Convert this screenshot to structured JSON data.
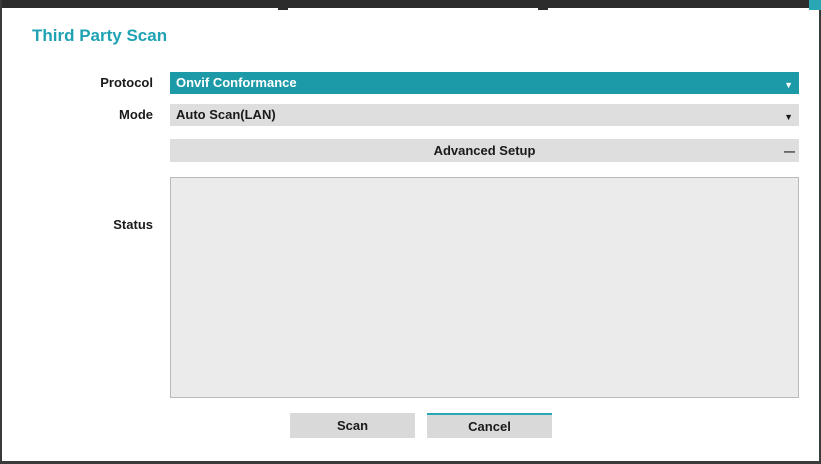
{
  "dialog": {
    "title": "Third Party Scan"
  },
  "form": {
    "protocol_label": "Protocol",
    "protocol_value": "Onvif Conformance",
    "mode_label": "Mode",
    "mode_value": "Auto Scan(LAN)",
    "advanced_label": "Advanced Setup",
    "status_label": "Status"
  },
  "buttons": {
    "scan_label": "Scan",
    "cancel_label": "Cancel"
  },
  "icons": {
    "dropdown": "chevron-down-icon",
    "collapse": "collapse-icon"
  },
  "colors": {
    "accent": "#1fa3b4",
    "selected_field": "#1d9aa8",
    "field_bg": "#dedede",
    "status_bg": "#ebebeb"
  }
}
